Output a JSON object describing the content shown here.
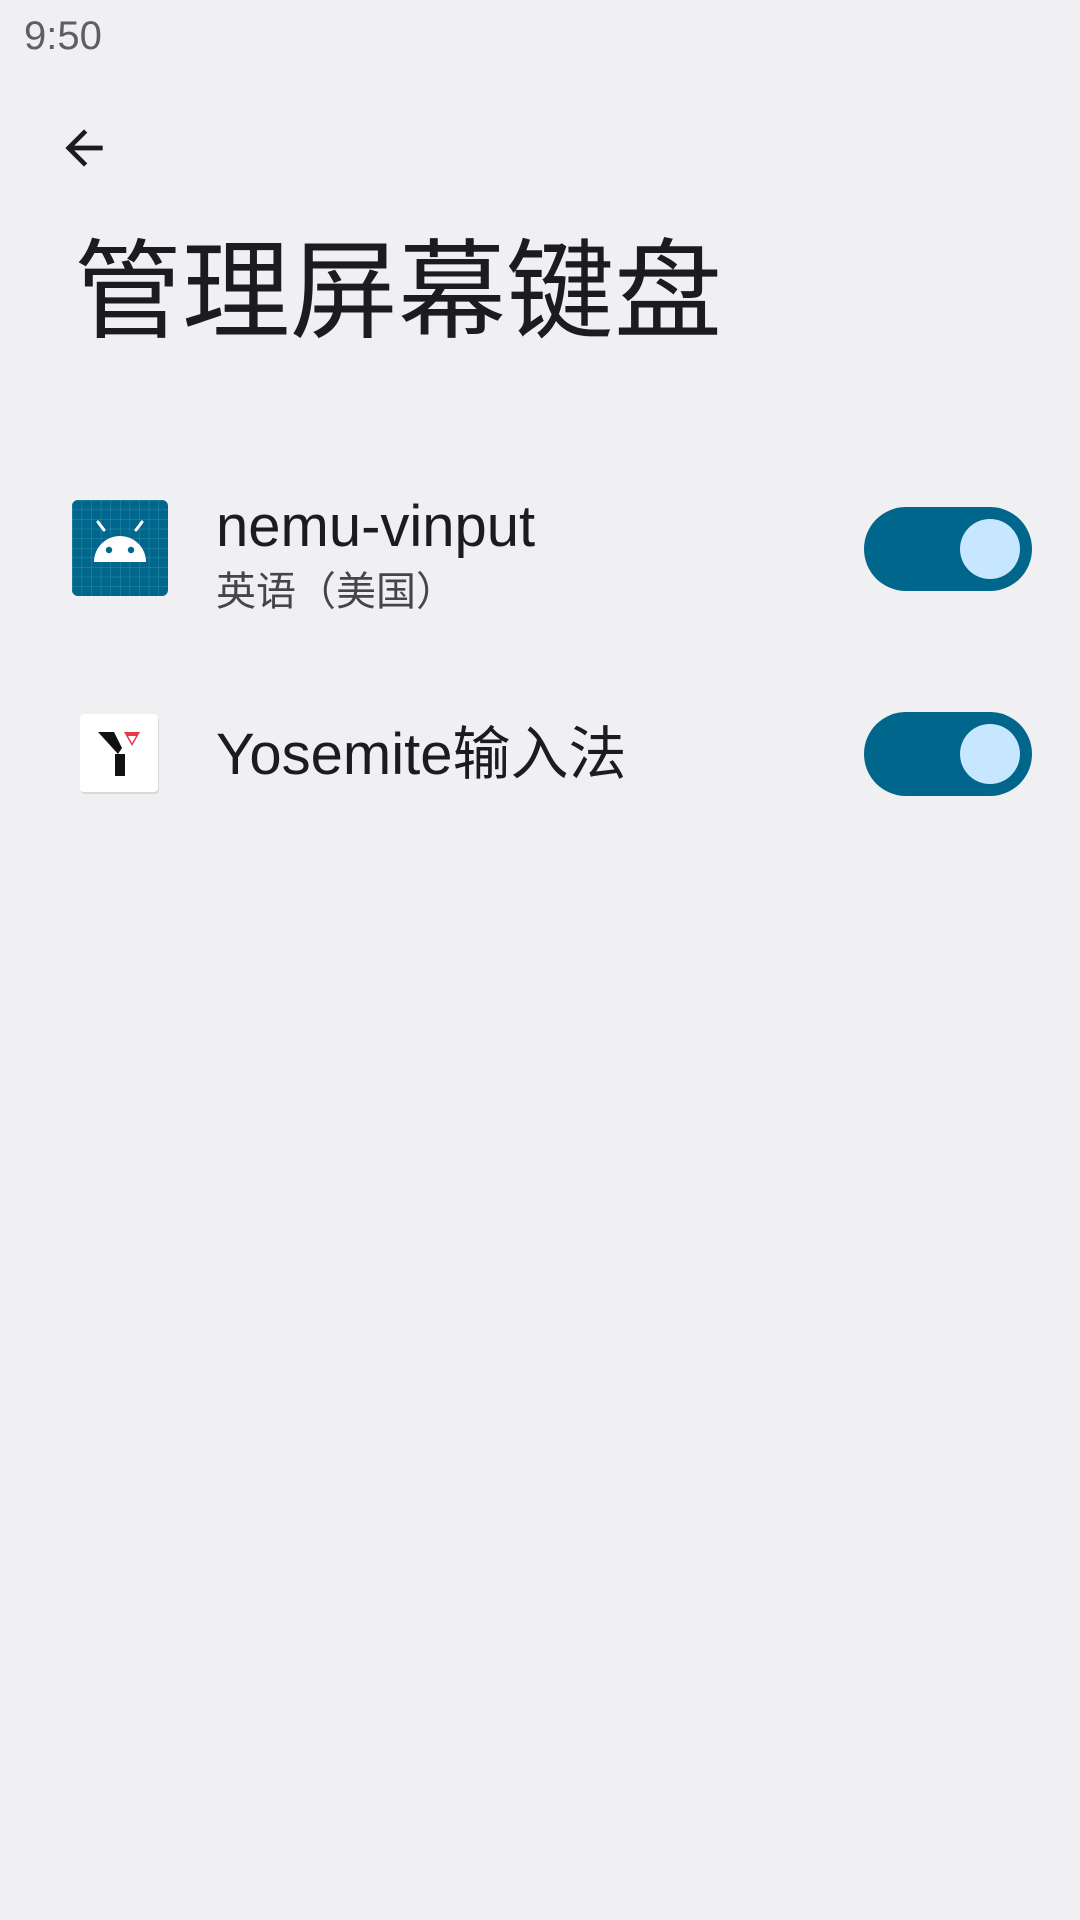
{
  "status_bar": {
    "time": "9:50"
  },
  "header": {
    "back_icon": "arrow-back-icon",
    "title": "管理屏幕键盘"
  },
  "input_methods": [
    {
      "name": "nemu-vinput",
      "subtitle": "英语（美国）",
      "icon": "android-robot-icon",
      "enabled": true
    },
    {
      "name": "Yosemite输入法",
      "icon": "yosemite-y-logo-icon",
      "enabled": true
    }
  ],
  "colors": {
    "background": "#f0eff2",
    "toggle_track_on": "#00668b",
    "toggle_thumb_on": "#c6e7ff",
    "android_icon_bg": "#00668b"
  }
}
